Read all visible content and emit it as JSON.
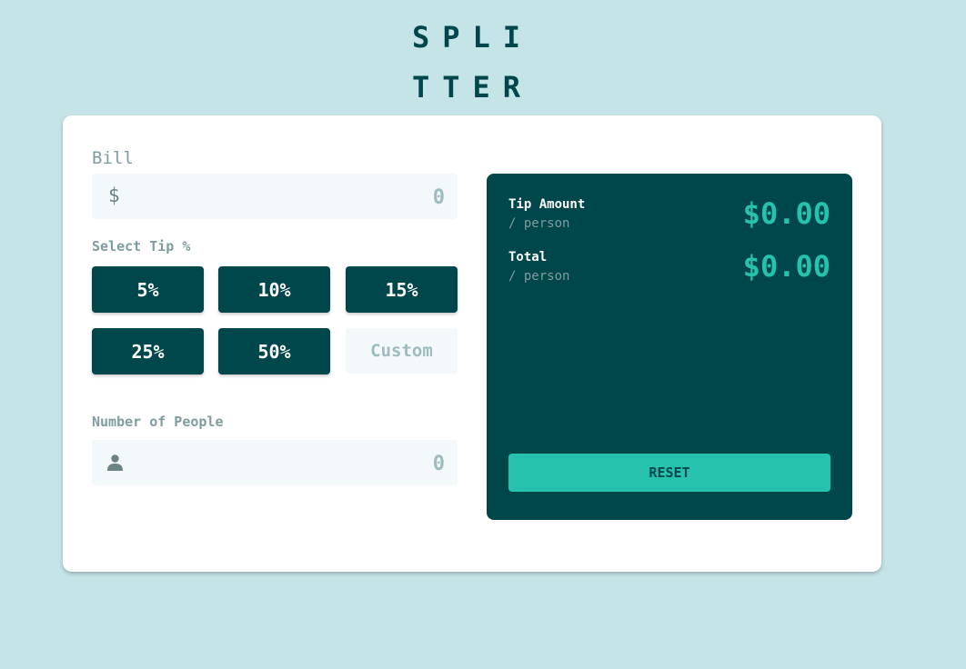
{
  "logo": {
    "line1": "SPLI",
    "line2": "TTER"
  },
  "bill": {
    "label": "Bill",
    "currency_symbol": "$",
    "value": "0"
  },
  "tip": {
    "label": "Select Tip %",
    "options": [
      "5%",
      "10%",
      "15%",
      "25%",
      "50%"
    ],
    "custom_placeholder": "Custom"
  },
  "people": {
    "label": "Number of People",
    "value": "0",
    "icon": "person-icon"
  },
  "results": {
    "tip_amount_label": "Tip Amount",
    "tip_amount_sub": "/ person",
    "tip_amount_value": "$0.00",
    "total_label": "Total",
    "total_sub": "/ person",
    "total_value": "$0.00",
    "reset_label": "RESET"
  },
  "colors": {
    "background": "#c5e4e7",
    "dark_cyan": "#00474b",
    "strong_cyan": "#26c2ae",
    "grayish_cyan": "#7f9c9f",
    "light_field": "#f3f9fa"
  }
}
